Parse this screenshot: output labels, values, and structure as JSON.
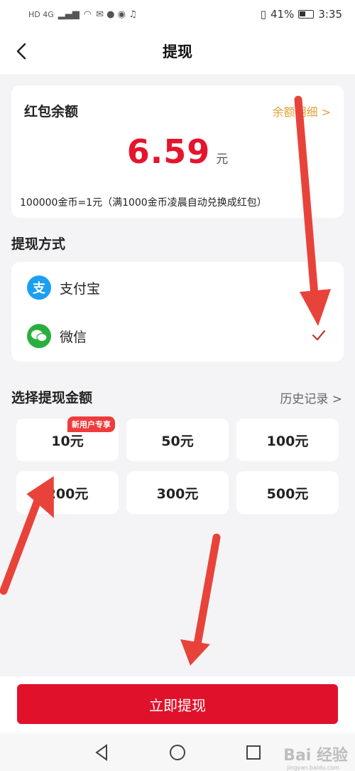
{
  "status_bar": {
    "left_text": "HD 4G",
    "battery": "41%",
    "time": "3:35"
  },
  "nav": {
    "title": "提现"
  },
  "balance": {
    "title": "红包余额",
    "detail_link": "余额明细 >",
    "amount": "6.59",
    "unit": "元",
    "note": "100000金币=1元（满1000金币凌晨自动兑换成红包）"
  },
  "withdraw_method": {
    "section_title": "提现方式",
    "methods": [
      {
        "label": "支付宝",
        "icon": "alipay-icon",
        "color": "#1a9ff1",
        "glyph": "支",
        "selected": false
      },
      {
        "label": "微信",
        "icon": "wechat-icon",
        "color": "#2aae3f",
        "glyph": "信",
        "selected": true
      }
    ]
  },
  "amount_select": {
    "section_title": "选择提现金额",
    "history_link": "历史记录 >",
    "badge": "新用户专享",
    "options": [
      "10元",
      "50元",
      "100元",
      "200元",
      "300元",
      "500元"
    ]
  },
  "submit": {
    "label": "立即提现"
  },
  "watermark": {
    "text": "Bai 经验",
    "sub": "jingyan.baidu.com"
  },
  "colors": {
    "accent_red": "#e0122b",
    "amount_red": "#e4152c",
    "link_gold": "#e2a13a",
    "annotation_arrow": "#e8433a"
  }
}
